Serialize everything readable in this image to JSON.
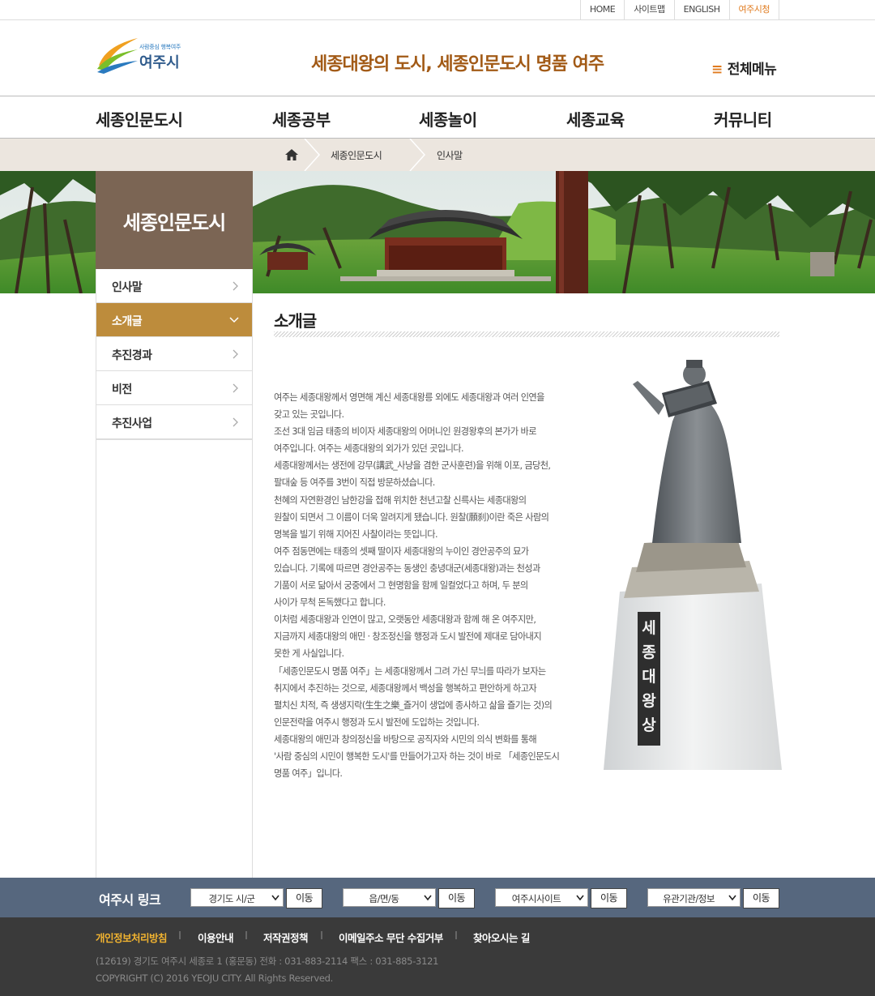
{
  "util_links": [
    {
      "label": "HOME",
      "active": false
    },
    {
      "label": "사이트맵",
      "active": false
    },
    {
      "label": "ENGLISH",
      "active": false
    },
    {
      "label": "여주시청",
      "active": true
    }
  ],
  "header": {
    "logo_sub": "사람중심 행복여주",
    "logo_name": "여주시",
    "slogan": "세종대왕의 도시, 세종인문도시 명품 여주",
    "all_menu": "전체메뉴"
  },
  "gnb": [
    "세종인문도시",
    "세종공부",
    "세종놀이",
    "세종교육",
    "커뮤니티"
  ],
  "breadcrumb": [
    "세종인문도시",
    "인사말"
  ],
  "lnb": {
    "title": "세종인문도시",
    "items": [
      {
        "label": "인사말",
        "active": false
      },
      {
        "label": "소개글",
        "active": true
      },
      {
        "label": "추진경과",
        "active": false
      },
      {
        "label": "비전",
        "active": false
      },
      {
        "label": "추진사업",
        "active": false
      }
    ]
  },
  "content": {
    "title": "소개글",
    "lines": [
      "여주는 세종대왕께서 영면해 계신 세종대왕릉 외에도 세종대왕과 여러 인연을",
      "갖고 있는 곳입니다.",
      "조선 3대 임금 태종의 비이자 세종대왕의 어머니인 원경왕후의 본가가 바로",
      "여주입니다. 여주는 세종대왕의 외가가 있던 곳입니다.",
      "세종대왕께서는 생전에 강무(講武_사냥을 겸한 군사훈련)을 위해 이포, 금당천,",
      "팔대숲 등 여주를 3번이 직접 방문하셨습니다.",
      "천혜의 자연환경인 남한강을 접해 위치한 천년고찰 신륵사는 세종대왕의",
      "원찰이 되면서 그 이름이 더욱 알려지게 됐습니다. 원찰(願刹)이란 죽은 사람의",
      "명복을 빌기 위해 지어진 사찰이라는 뜻입니다.",
      "여주 점동면에는 태종의 셋째 딸이자 세종대왕의 누이인 경안공주의 묘가",
      "있습니다. 기록에 따르면 경안공주는 동생인 충녕대군(세종대왕)과는 천성과",
      "기품이 서로 닮아서 궁중에서 그 현명함을 함께 일컬었다고 하며, 두 분의",
      "사이가 무척 돈독했다고 합니다.",
      "이처럼 세종대왕과 인연이 많고, 오랫동안 세종대왕과 함께 해 온 여주지만,",
      "지금까지 세종대왕의 애민 · 창조정신을 행정과 도시 발전에 제대로 담아내지",
      "못한 게 사실입니다.",
      "「세종인문도시 명품 여주」는 세종대왕께서 그려 가신 무늬를 따라가 보자는",
      "취지에서 추진하는 것으로, 세종대왕께서 백성을 행복하고 편안하게 하고자",
      "펼치신 치적, 즉 생생지락(生生之樂_즐거이 생업에 종사하고 삶을 즐기는 것)의",
      "인문전략을 여주시 행정과 도시 발전에 도입하는 것입니다.",
      "세종대왕의 애민과 창의정신을 바탕으로 공직자와 시민의 의식 변화를 통해",
      "'사람 중심의 시민이 행복한 도시'를 만들어가고자 하는 것이 바로 「세종인문도시",
      "명품 여주」입니다."
    ],
    "statue_inscription": "세종대왕상"
  },
  "linkbar": {
    "title": "여주시 링크",
    "selects": [
      "경기도 시/군",
      "읍/면/동",
      "여주시사이트",
      "유관기관/정보"
    ],
    "go_label": "이동"
  },
  "footer": {
    "links": [
      {
        "label": "개인정보처리방침",
        "highlight": true
      },
      {
        "label": "이용안내",
        "highlight": false
      },
      {
        "label": "저작권정책",
        "highlight": false
      },
      {
        "label": "이메일주소 무단 수집거부",
        "highlight": false
      },
      {
        "label": "찾아오시는 길",
        "highlight": false
      }
    ],
    "address": "(12619) 경기도 여주시 세종로 1 (홍문동)   전화 : 031-883-2114   팩스 : 031-885-3121",
    "copyright": "COPYRIGHT (C) 2016 YEOJU CITY. All Rights Reserved."
  },
  "colors": {
    "accent_gold": "#bd8c3c",
    "lnb_title_bg": "#7b6554",
    "slogan": "#a25a16",
    "orange": "#e07b1f",
    "linkbar_bg": "#56677e",
    "footer_bg": "#3a3a3a"
  }
}
